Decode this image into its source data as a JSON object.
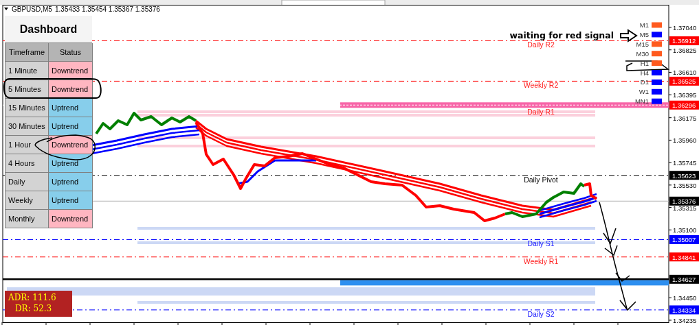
{
  "chart": {
    "symbol": "GBPUSD,M5",
    "ohlc": "1.35433 1.35454 1.35367 1.35376"
  },
  "dashboard": {
    "title": "Dashboard",
    "columns": [
      "Timeframe",
      "Status"
    ],
    "rows": [
      {
        "timeframe": "1 Minute",
        "status": "Downtrend",
        "color": "#ffb6c1"
      },
      {
        "timeframe": "5 Minutes",
        "status": "Downtrend",
        "color": "#ffb6c1"
      },
      {
        "timeframe": "15 Minutes",
        "status": "Uptrend",
        "color": "#87ceeb"
      },
      {
        "timeframe": "30 Minutes",
        "status": "Uptrend",
        "color": "#87ceeb"
      },
      {
        "timeframe": "1 Hour",
        "status": "Downtrend",
        "color": "#ffb6c1"
      },
      {
        "timeframe": "4 Hours",
        "status": "Uptrend",
        "color": "#87ceeb"
      },
      {
        "timeframe": "Daily",
        "status": "Uptrend",
        "color": "#87ceeb"
      },
      {
        "timeframe": "Weekly",
        "status": "Uptrend",
        "color": "#87ceeb"
      },
      {
        "timeframe": "Monthly",
        "status": "Downtrend",
        "color": "#ffb6c1"
      }
    ]
  },
  "signal_panel": [
    {
      "label": "M1",
      "color": "#ff5a1e"
    },
    {
      "label": "M5",
      "color": "#0000ff"
    },
    {
      "label": "M15",
      "color": "#ff5a1e"
    },
    {
      "label": "M30",
      "color": "#ff5a1e"
    },
    {
      "label": "H1",
      "color": "#ff5a1e"
    },
    {
      "label": "H4",
      "color": "#0000ff"
    },
    {
      "label": "D1",
      "color": "#0000ff"
    },
    {
      "label": "W1",
      "color": "#0000ff"
    },
    {
      "label": "MN1",
      "color": "#0000ff"
    }
  ],
  "note": "waiting for red signal",
  "levels": [
    {
      "name": "Daily R2",
      "price": "1.36912",
      "kind": "resistance"
    },
    {
      "name": "Weekly R2",
      "price": "1.36525",
      "kind": "resistance"
    },
    {
      "name": "Daily R1",
      "price": "1.36296",
      "kind": "band-pink"
    },
    {
      "name": "Daily Pivot",
      "price": "1.35623",
      "kind": "pivot"
    },
    {
      "price": "1.35376",
      "kind": "current"
    },
    {
      "name": "Daily S1",
      "price": "1.35007",
      "kind": "support"
    },
    {
      "name": "Weekly R1",
      "price": "1.34841",
      "kind": "resistance"
    },
    {
      "price": "1.34627",
      "kind": "band-blue"
    },
    {
      "name": "Daily S2",
      "price": "1.34334",
      "kind": "support"
    }
  ],
  "price_axis": [
    "1.37040",
    "1.36825",
    "1.36610",
    "1.36395",
    "1.36175",
    "1.35960",
    "1.35745",
    "1.35530",
    "1.35315",
    "1.35100",
    "1.34450",
    "1.34235"
  ],
  "adr": {
    "adr": "ADR: 111.6",
    "dr": "DR: 52.3"
  }
}
